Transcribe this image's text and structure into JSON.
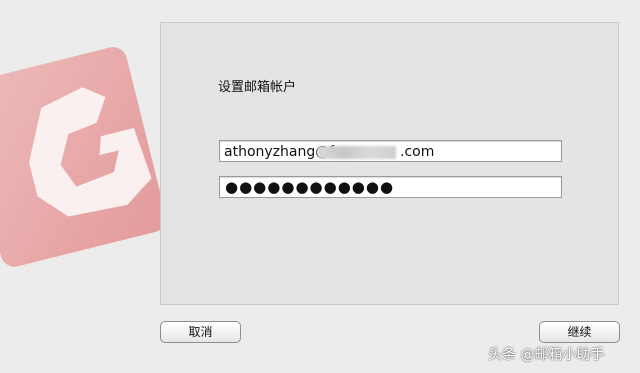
{
  "dialog": {
    "heading": "设置邮箱帐户",
    "email_prefix": "athonyzhang@f",
    "email_suffix": ".com",
    "password_mask": "●●●●●●●●●●●●"
  },
  "buttons": {
    "cancel_label": "取消",
    "continue_label": "继续"
  },
  "watermark": {
    "text": "头条 @邮箱小助手"
  },
  "icons": {
    "background_logo": "foxmail-logo-icon",
    "watermark_logo": "toutiao-logo-icon"
  },
  "colors": {
    "logo_red": "#e9a6a6",
    "panel_bg": "#e4e4e4",
    "window_bg": "#ececec"
  }
}
